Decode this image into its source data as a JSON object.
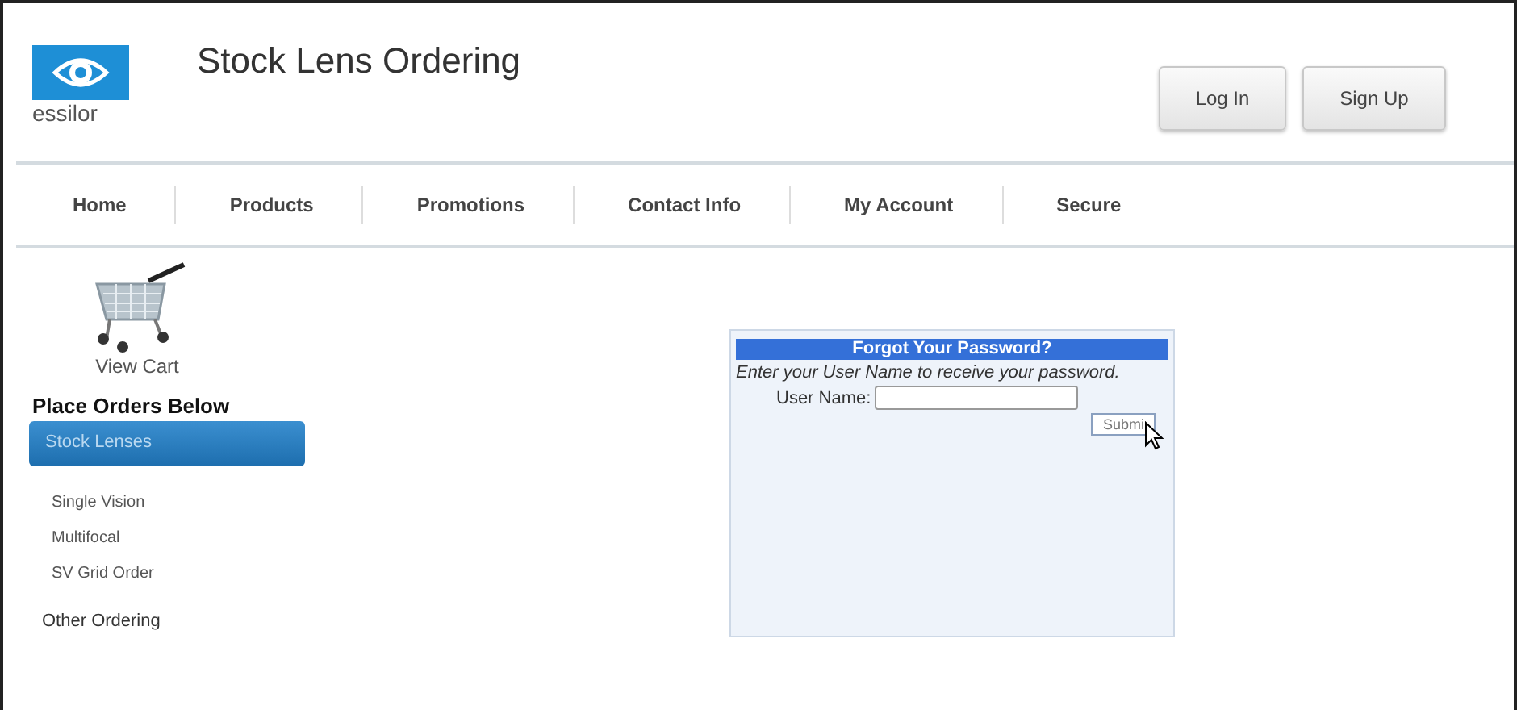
{
  "logo": {
    "wordmark": "essilor"
  },
  "header": {
    "title": "Stock Lens Ordering",
    "buttons": [
      "Log In",
      "Sign Up"
    ]
  },
  "nav": [
    "Home",
    "Products",
    "Promotions",
    "Contact Info",
    "My Account",
    "Secure"
  ],
  "sidebar": {
    "cart_label": "View Cart",
    "heading": "Place Orders Below",
    "items": [
      {
        "label": "Stock Lenses",
        "kind": "section",
        "selected": true
      },
      {
        "label": "Single Vision",
        "kind": "sub",
        "selected": false
      },
      {
        "label": "Multifocal",
        "kind": "sub",
        "selected": false
      },
      {
        "label": "SV Grid Order",
        "kind": "sub",
        "selected": false
      },
      {
        "label": "Other Ordering",
        "kind": "section",
        "selected": false
      }
    ]
  },
  "form": {
    "title": "Forgot Your Password?",
    "instruction": "Enter your User Name to receive your password.",
    "field_label": "User Name:",
    "submit": "Submi"
  }
}
